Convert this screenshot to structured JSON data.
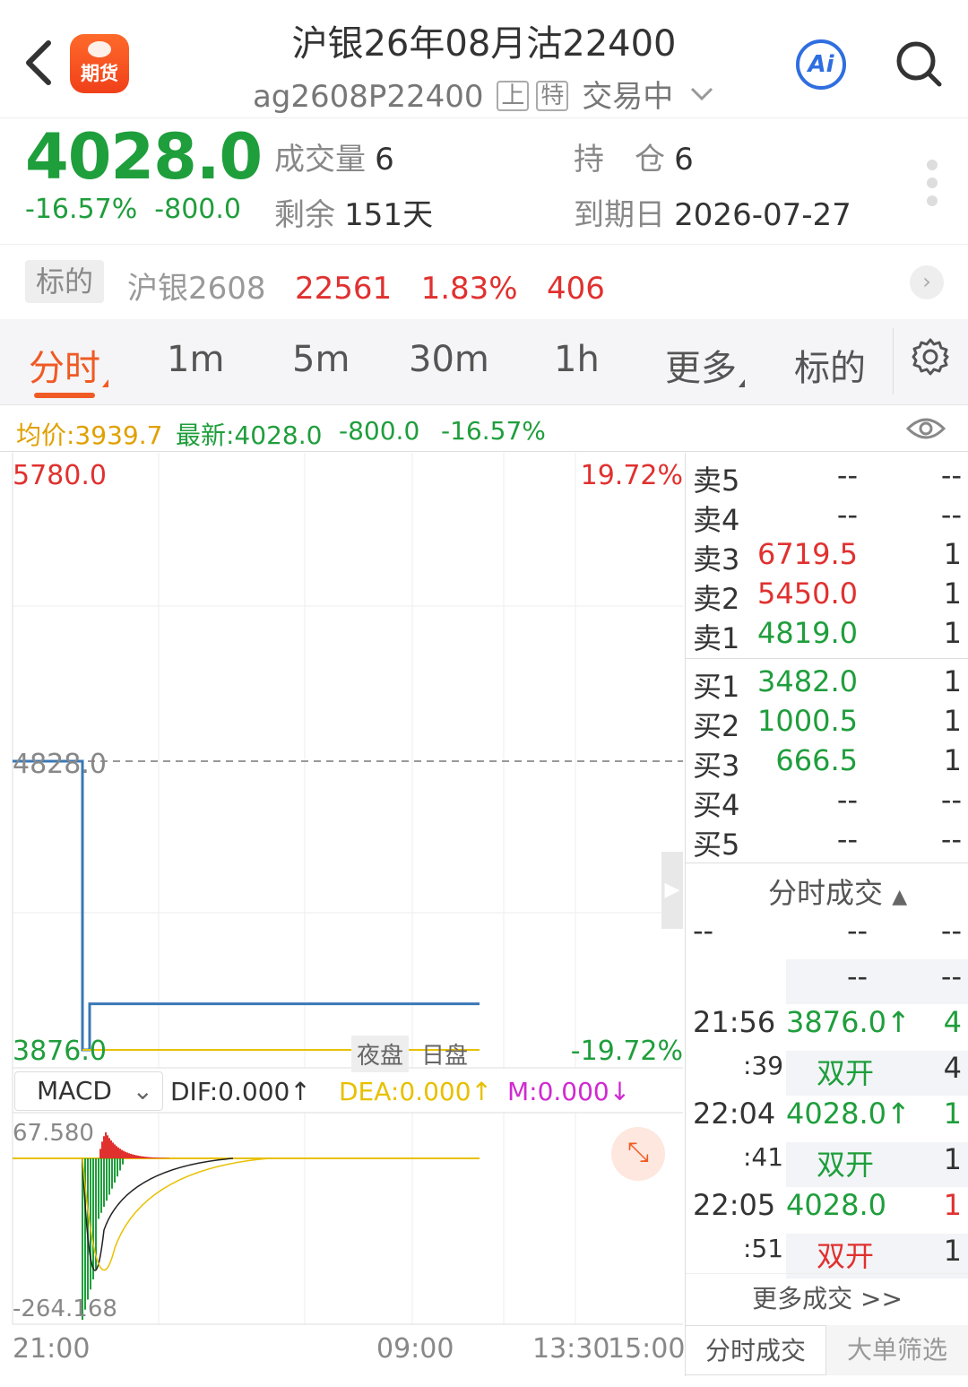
{
  "header": {
    "logo_text": "期货",
    "title": "沪银26年08月沽22400",
    "code": "ag2608P22400",
    "tag1": "上",
    "tag2": "特",
    "status": "交易中",
    "ai_label": "Ai"
  },
  "quote": {
    "price": "4028.0",
    "pct": "-16.57%",
    "change": "-800.0",
    "volume_label": "成交量",
    "volume": "6",
    "oi_label": "持　仓",
    "oi": "6",
    "remain_label": "剩余",
    "remain": "151天",
    "expiry_label": "到期日",
    "expiry": "2026-07-27"
  },
  "underlying": {
    "tag": "标的",
    "name": "沪银2608",
    "price": "22561",
    "pct": "1.83%",
    "change": "406"
  },
  "tabs": [
    "分时",
    "1m",
    "5m",
    "30m",
    "1h",
    "更多",
    "标的"
  ],
  "info": {
    "avg": "均价:3939.7",
    "latest": "最新:4028.0",
    "change": "-800.0",
    "pct": "-16.57%"
  },
  "chart": {
    "y_high": "5780.0",
    "y_mid": "4828.0",
    "y_low": "3876.0",
    "pct_high": "19.72%",
    "pct_low": "-19.72%",
    "session_night": "夜盘",
    "session_day": "日盘",
    "x_labels": [
      "21:00",
      "09:00",
      "13:30",
      "15:00"
    ]
  },
  "macd": {
    "label": "MACD",
    "dif": "DIF:0.000",
    "dea": "DEA:0.000",
    "m": "M:0.000",
    "top": "67.580",
    "bottom": "-264.168"
  },
  "orderbook": {
    "asks": [
      {
        "n": "卖5",
        "p": "--",
        "v": "--"
      },
      {
        "n": "卖4",
        "p": "--",
        "v": "--"
      },
      {
        "n": "卖3",
        "p": "6719.5",
        "v": "1"
      },
      {
        "n": "卖2",
        "p": "5450.0",
        "v": "1"
      },
      {
        "n": "卖1",
        "p": "4819.0",
        "v": "1"
      }
    ],
    "bids": [
      {
        "n": "买1",
        "p": "3482.0",
        "v": "1"
      },
      {
        "n": "买2",
        "p": "1000.5",
        "v": "1"
      },
      {
        "n": "买3",
        "p": "666.5",
        "v": "1"
      },
      {
        "n": "买4",
        "p": "--",
        "v": "--"
      },
      {
        "n": "买5",
        "p": "--",
        "v": "--"
      }
    ],
    "ticks_title": "分时成交",
    "ticks": [
      {
        "time": "--",
        "price": "--",
        "vol": "--",
        "sub_time": "",
        "kind": "--",
        "sub_vol": "--"
      },
      {
        "time": "21:56",
        "price": "3876.0↑",
        "vol": "4",
        "sub_time": ":39",
        "kind": "双开",
        "sub_vol": "4"
      },
      {
        "time": "22:04",
        "price": "4028.0↑",
        "vol": "1",
        "sub_time": ":41",
        "kind": "双开",
        "sub_vol": "1"
      },
      {
        "time": "22:05",
        "price": "4028.0",
        "vol": "1",
        "sub_time": ":51",
        "kind": "双开",
        "sub_vol": "1"
      }
    ],
    "more": "更多成交 >>",
    "footer_tabs": [
      "分时成交",
      "大单筛选"
    ]
  },
  "chart_data": {
    "type": "line",
    "series": [
      {
        "values": [
          4828.0,
          3876.0,
          3876.0,
          4028.0,
          4028.0
        ],
        "x": [
          "21:00",
          "21:56",
          "22:03",
          "22:04",
          "22:05"
        ]
      },
      {
        "values": [
          3876.0,
          3939.7
        ],
        "x": [
          "21:56",
          "22:05"
        ]
      }
    ],
    "ylim": [
      3876.0,
      5780.0
    ],
    "x_ticks": [
      "21:00",
      "09:00",
      "13:30",
      "15:00"
    ]
  }
}
